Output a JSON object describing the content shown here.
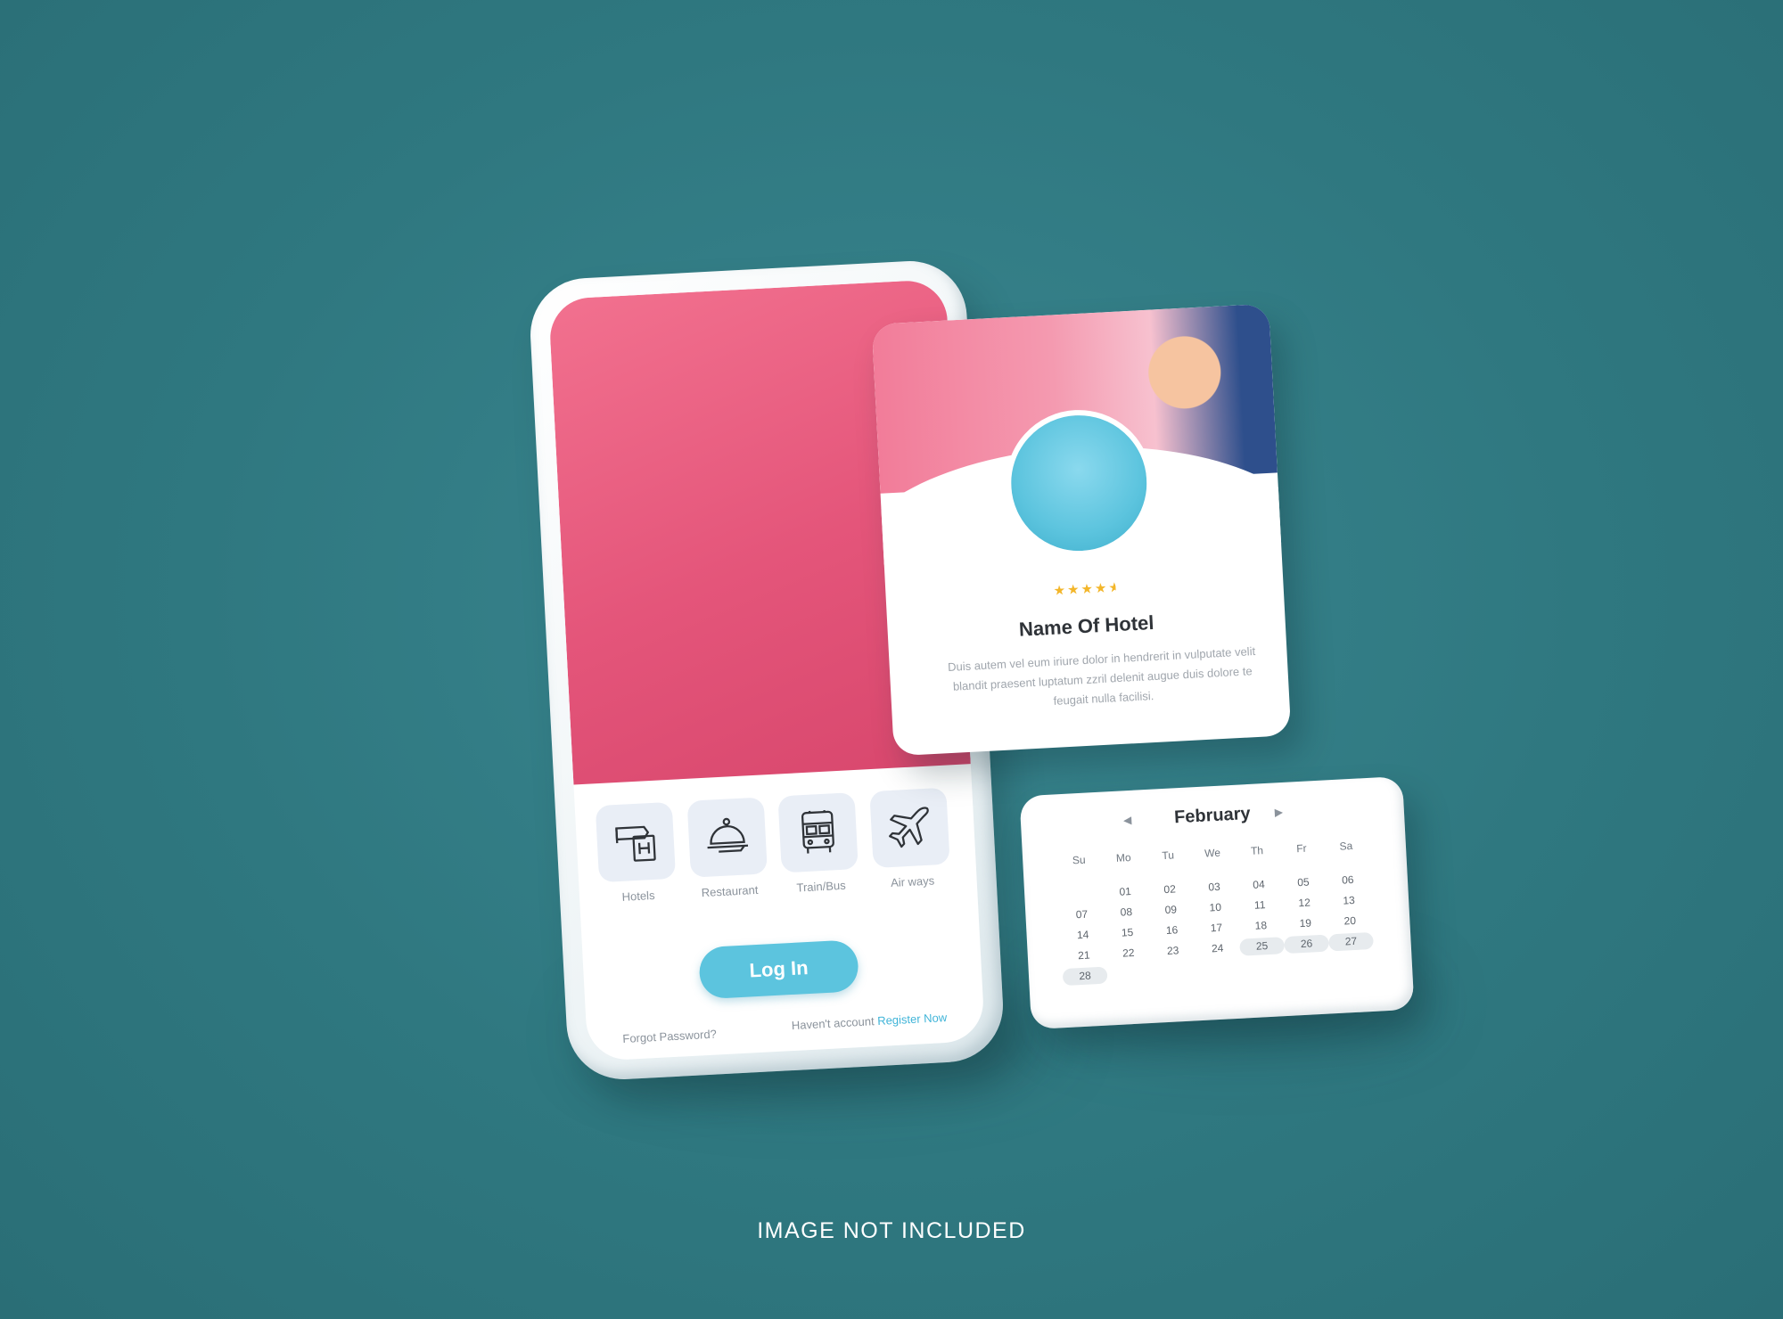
{
  "app": {
    "services": [
      {
        "label": "Hotels",
        "icon": "hotel-icon"
      },
      {
        "label": "Restaurant",
        "icon": "restaurant-cloche-icon"
      },
      {
        "label": "Train/Bus",
        "icon": "bus-icon"
      },
      {
        "label": "Air ways",
        "icon": "airplane-icon"
      }
    ],
    "login_label": "Log In",
    "forgot_label": "Forgot Password?",
    "register_prompt": "Haven't account",
    "register_link": "Register Now"
  },
  "hotel": {
    "rating": 4.5,
    "name": "Name Of Hotel",
    "description": "Duis autem vel eum iriure dolor in hendrerit in vulputate velit blandit praesent luptatum zzril delenit augue duis dolore te feugait nulla facilisi."
  },
  "calendar": {
    "month": "February",
    "weekdays": [
      "Su",
      "Mo",
      "Tu",
      "We",
      "Th",
      "Fr",
      "Sa"
    ],
    "weeks": [
      [
        "",
        "01",
        "02",
        "03",
        "04",
        "05",
        "06"
      ],
      [
        "07",
        "08",
        "09",
        "10",
        "11",
        "12",
        "13"
      ],
      [
        "14",
        "15",
        "16",
        "17",
        "18",
        "19",
        "20"
      ],
      [
        "21",
        "22",
        "23",
        "24",
        "25",
        "26",
        "27"
      ],
      [
        "28",
        "",
        "",
        "",
        "",
        "",
        ""
      ]
    ],
    "highlighted": [
      "25",
      "26",
      "27",
      "28"
    ]
  },
  "caption": "IMAGE NOT INCLUDED",
  "colors": {
    "background": "#2f7880",
    "accent": "#5cc4de",
    "hero_pink": "#e4557a",
    "star": "#f3b62a"
  }
}
